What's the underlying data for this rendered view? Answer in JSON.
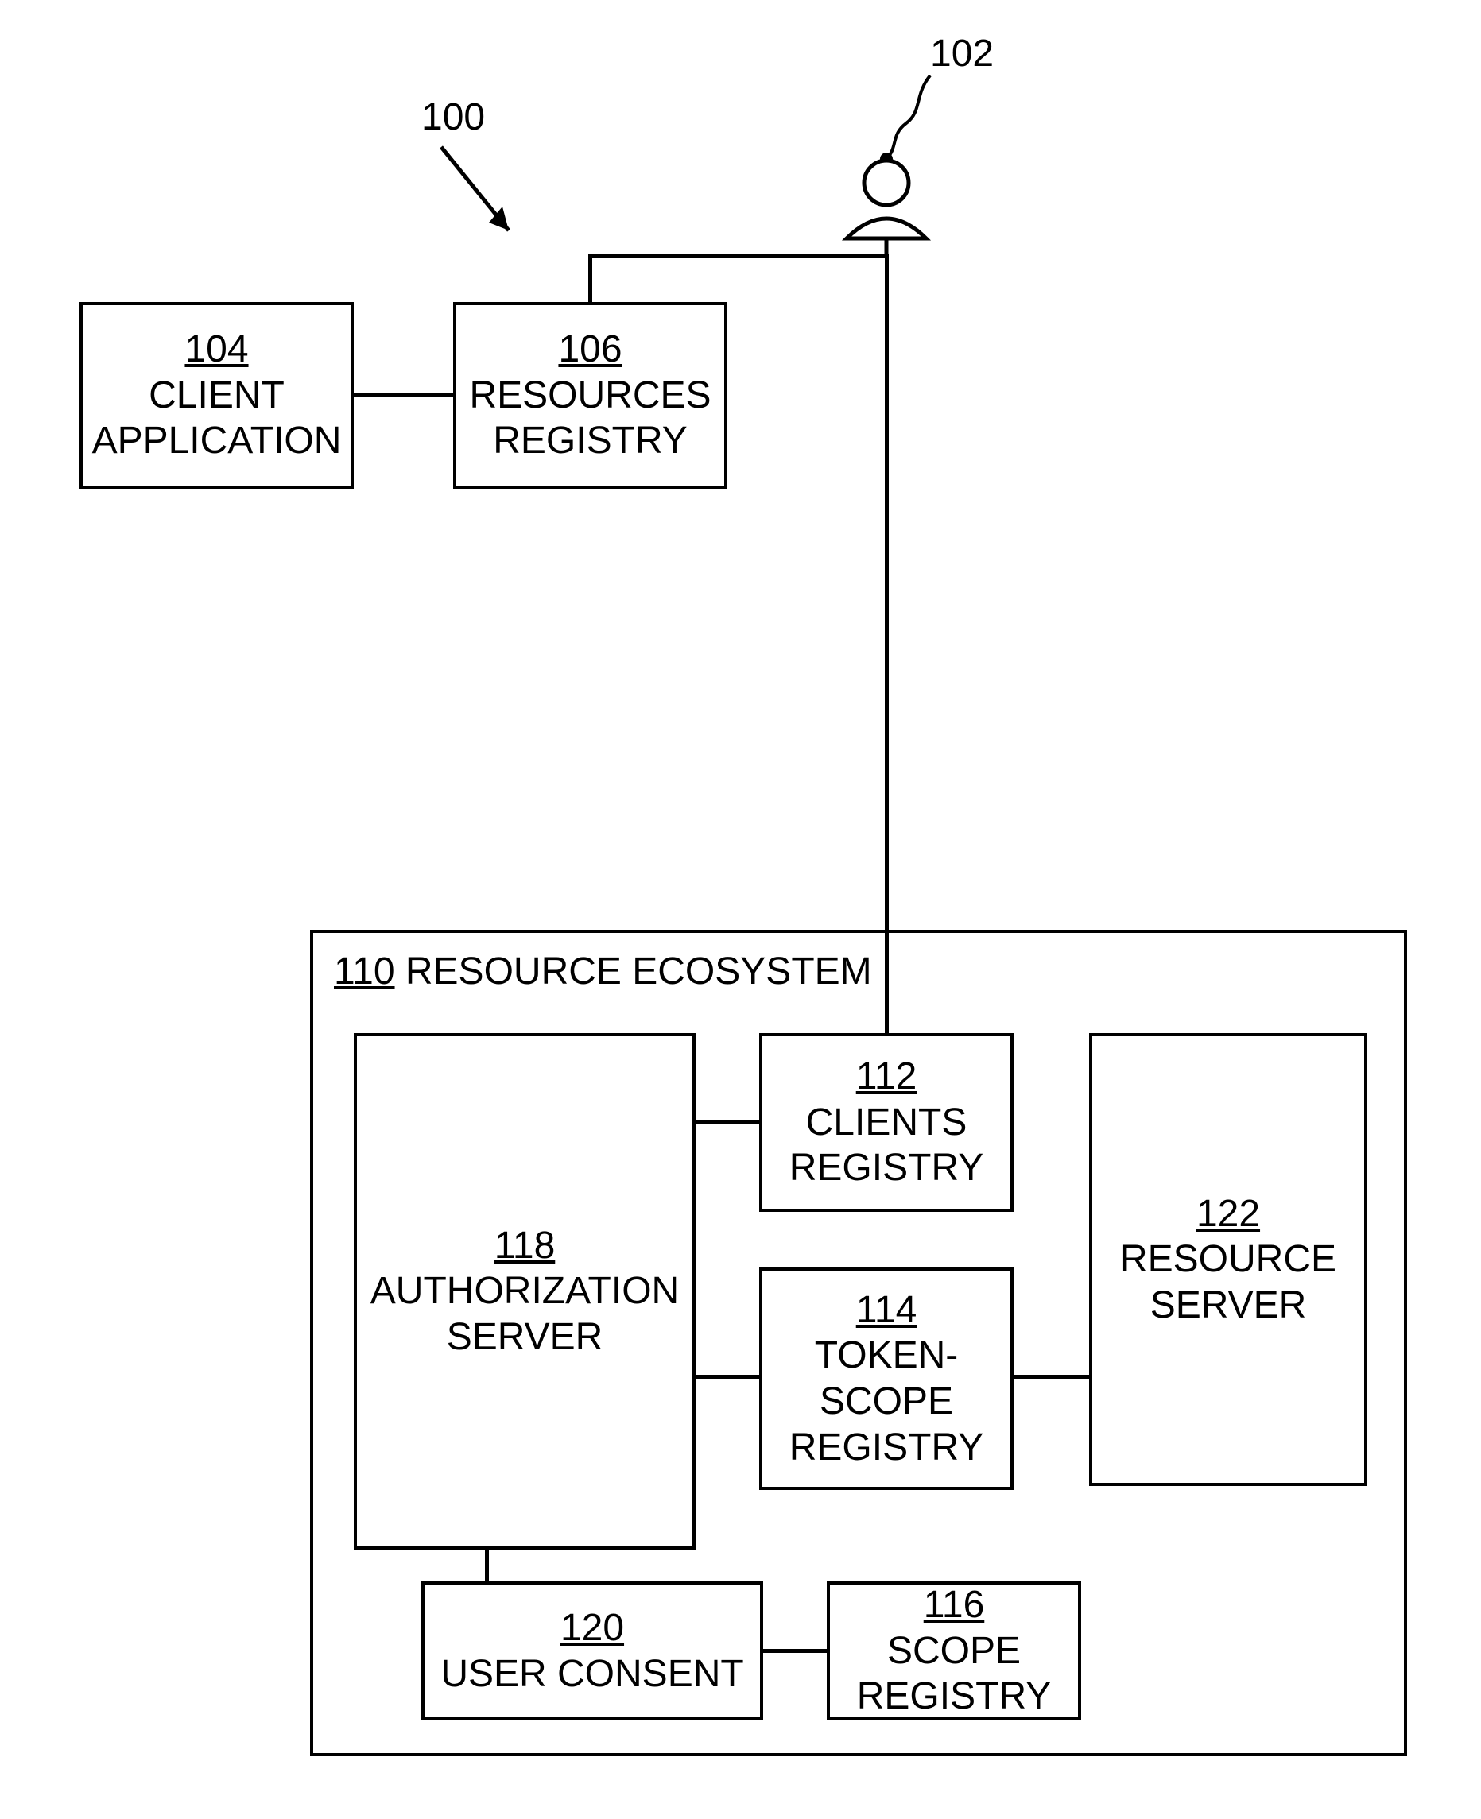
{
  "refs": {
    "r100": "100",
    "r102": "102"
  },
  "blocks": {
    "client_app": {
      "num": "104",
      "label1": "CLIENT",
      "label2": "APPLICATION"
    },
    "resources_registry": {
      "num": "106",
      "label1": "RESOURCES",
      "label2": "REGISTRY"
    },
    "ecosystem": {
      "num": "110",
      "label": "RESOURCE ECOSYSTEM"
    },
    "clients_registry": {
      "num": "112",
      "label1": "CLIENTS",
      "label2": "REGISTRY"
    },
    "token_scope": {
      "num": "114",
      "label1": "TOKEN-",
      "label2": "SCOPE",
      "label3": "REGISTRY"
    },
    "scope_registry": {
      "num": "116",
      "label1": "SCOPE",
      "label2": "REGISTRY"
    },
    "auth_server": {
      "num": "118",
      "label1": "AUTHORIZATION",
      "label2": "SERVER"
    },
    "user_consent": {
      "num": "120",
      "label": "USER CONSENT"
    },
    "resource_server": {
      "num": "122",
      "label1": "RESOURCE",
      "label2": "SERVER"
    }
  }
}
